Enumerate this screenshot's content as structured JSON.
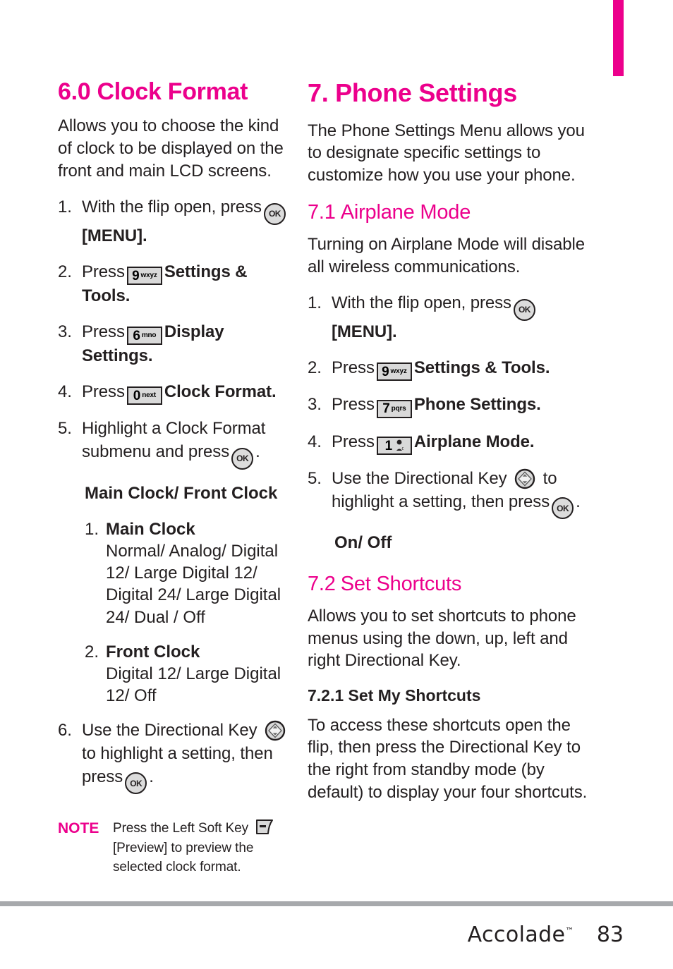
{
  "colors": {
    "accent_pink": "#ec008c",
    "text": "#231f20",
    "footer_rule": "#a7a9ac",
    "key_fill": "#d9d9d9"
  },
  "tab_marker": {
    "name": "chapter-tab-marker"
  },
  "left_column": {
    "heading": "6.0 Clock Format",
    "heading_number": "6.0",
    "heading_title": "Clock Format",
    "intro": "Allows you to choose the kind of clock to be displayed on the front and main  LCD screens.",
    "steps": [
      {
        "num": "1.",
        "before": "With the flip open, press",
        "icon": "ok-key",
        "after": "[MENU].",
        "after_bold": true
      },
      {
        "num": "2.",
        "before": "Press",
        "icon": "keypad-9",
        "key_digit": "9",
        "key_letters": "wxyz",
        "after": "Settings & Tools.",
        "after_bold": true
      },
      {
        "num": "3.",
        "before": "Press",
        "icon": "keypad-6",
        "key_digit": "6",
        "key_letters": "mno",
        "after": "Display Settings.",
        "after_bold": true
      },
      {
        "num": "4.",
        "before": "Press",
        "icon": "keypad-0",
        "key_digit": "0",
        "key_letters": "next",
        "after": "Clock Format.",
        "after_bold": true
      },
      {
        "num": "5.",
        "before": "Highlight a Clock Format submenu and press",
        "icon": "ok-key",
        "after": ".",
        "after_bold": false
      }
    ],
    "submenu_heading": "Main Clock/ Front Clock",
    "submenu_items": [
      {
        "num": "1.",
        "title": "Main Clock",
        "options": "Normal/ Analog/ Digital 12/ Large Digital 12/ Digital 24/ Large Digital 24/ Dual / Off"
      },
      {
        "num": "2.",
        "title": "Front Clock",
        "options": "Digital 12/ Large Digital 12/ Off"
      }
    ],
    "final_step": {
      "num": "6.",
      "before": "Use the Directional Key",
      "icon": "directional-key",
      "middle": "to highlight a setting, then press",
      "icon2": "ok-key",
      "after": "."
    },
    "note": {
      "label": "NOTE",
      "before": "Press the Left Soft Key",
      "icon": "left-soft-key",
      "after": "[Preview] to preview the selected clock format."
    }
  },
  "right_column": {
    "heading": "7. Phone Settings",
    "intro": "The Phone Settings Menu allows you to designate specific settings to customize how you use your phone.",
    "subsection_1": {
      "number": "7.1",
      "title": "Airplane Mode",
      "intro": "Turning on Airplane Mode will disable all wireless communications.",
      "steps": [
        {
          "num": "1.",
          "before": "With the flip open, press",
          "icon": "ok-key",
          "after": "[MENU].",
          "after_bold": true
        },
        {
          "num": "2.",
          "before": "Press",
          "icon": "keypad-9",
          "key_digit": "9",
          "key_letters": "wxyz",
          "after": "Settings & Tools.",
          "after_bold": true
        },
        {
          "num": "3.",
          "before": "Press",
          "icon": "keypad-7",
          "key_digit": "7",
          "key_letters": "pqrs",
          "after": "Phone Settings.",
          "after_bold": true
        },
        {
          "num": "4.",
          "before": "Press",
          "icon": "keypad-1-voicemail",
          "key_digit": "1",
          "key_letters": "",
          "after": "Airplane Mode.",
          "after_bold": true
        }
      ],
      "final_step": {
        "num": "5.",
        "before": "Use the Directional Key",
        "icon": "directional-key",
        "middle": "to highlight a setting, then press",
        "icon2": "ok-key",
        "after": "."
      },
      "options": "On/ Off"
    },
    "subsection_2": {
      "number": "7.2",
      "title": "Set Shortcuts",
      "intro": "Allows you to set shortcuts to phone menus using the down, up, left and right Directional Key.",
      "sub_heading": "7.2.1 Set My Shortcuts",
      "sub_body": "To access these shortcuts open the flip, then press the Directional Key to the right from standby mode (by default) to display your four shortcuts."
    }
  },
  "footer": {
    "brand": "Accolade",
    "trademark": "™",
    "page_number": "83"
  }
}
